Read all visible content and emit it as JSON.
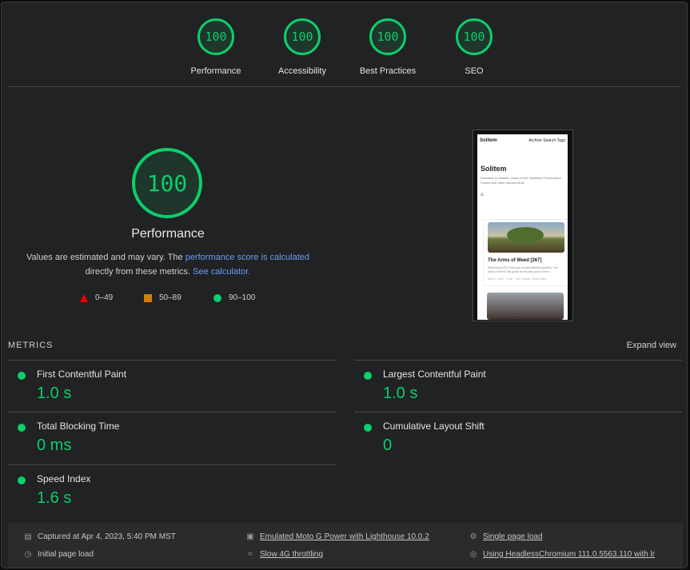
{
  "gauges": [
    {
      "score": "100",
      "label": "Performance"
    },
    {
      "score": "100",
      "label": "Accessibility"
    },
    {
      "score": "100",
      "label": "Best Practices"
    },
    {
      "score": "100",
      "label": "SEO"
    }
  ],
  "main": {
    "score": "100",
    "title": "Performance",
    "desc_prefix": "Values are estimated and may vary. The ",
    "desc_link1": "performance score is calculated",
    "desc_middle": " directly from these metrics. ",
    "desc_link2": "See calculator.",
    "legend": [
      {
        "shape": "triangle",
        "label": "0–49",
        "color": "#e00"
      },
      {
        "shape": "square",
        "label": "50–89",
        "color": "#d27f00"
      },
      {
        "shape": "circle",
        "label": "90–100",
        "color": "#0cce6b"
      }
    ]
  },
  "thumbnail": {
    "site": "Solitem",
    "nav": [
      "Archive",
      "Search",
      "Tags"
    ],
    "heading": "Solitem",
    "intro": "Welcome to Solitem. Home to the Hydaelyn Preservation Project and other random stuff.",
    "card_title": "The Arms of Meed [267]",
    "card_text": "Stormblood [57] Post may contain potential spoilers. The Arms of Meed This guide be the best point of ther...",
    "card_meta": "April 1, 2023 · 7 min · 1347 words · Rhad Saba"
  },
  "metrics": {
    "header": "METRICS",
    "expand": "Expand view",
    "items": [
      {
        "name": "First Contentful Paint",
        "value": "1.0 s"
      },
      {
        "name": "Largest Contentful Paint",
        "value": "1.0 s"
      },
      {
        "name": "Total Blocking Time",
        "value": "0 ms"
      },
      {
        "name": "Cumulative Layout Shift",
        "value": "0"
      },
      {
        "name": "Speed Index",
        "value": "1.6 s"
      }
    ]
  },
  "footer": {
    "captured": "Captured at Apr 4, 2023, 5:40 PM MST",
    "initial": "Initial page load",
    "device": "Emulated Moto G Power with Lighthouse 10.0.2",
    "throttling": "Slow 4G throttling",
    "single": "Single page load",
    "browser": "Using HeadlessChromium 111.0.5563.110 with lr"
  },
  "colors": {
    "pass": "#0cce6b",
    "average": "#d27f00",
    "fail": "#e00",
    "link": "#669df6"
  }
}
